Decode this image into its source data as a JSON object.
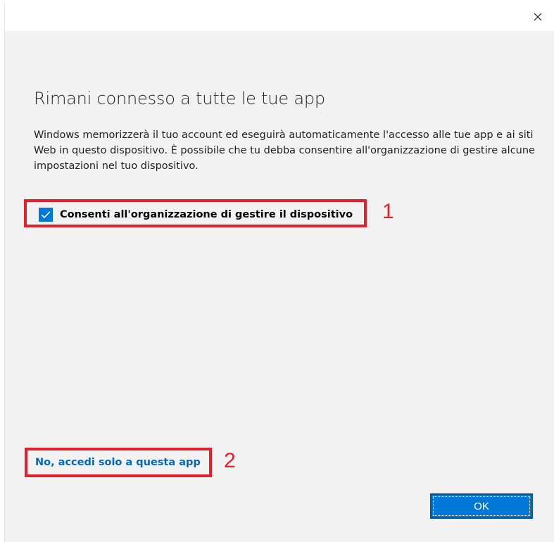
{
  "window": {
    "close_icon": "close-icon"
  },
  "dialog": {
    "title": "Rimani connesso a tutte le tue app",
    "description": "Windows memorizzerà il tuo account ed eseguirà automaticamente l'accesso alle tue app e ai siti Web in questo dispositivo. È possibile che tu debba consentire all'organizzazione di gestire alcune impostazioni nel tuo dispositivo.",
    "checkbox": {
      "label": "Consenti all'organizzazione di gestire il dispositivo",
      "checked": true
    },
    "link_text": "No, accedi solo a questa app",
    "ok_label": "OK"
  },
  "annotations": {
    "marker_1": "1",
    "marker_2": "2",
    "highlight_color": "#e0222c"
  },
  "colors": {
    "accent": "#0078d7",
    "link": "#0067c0",
    "background": "#f2f2f2"
  }
}
